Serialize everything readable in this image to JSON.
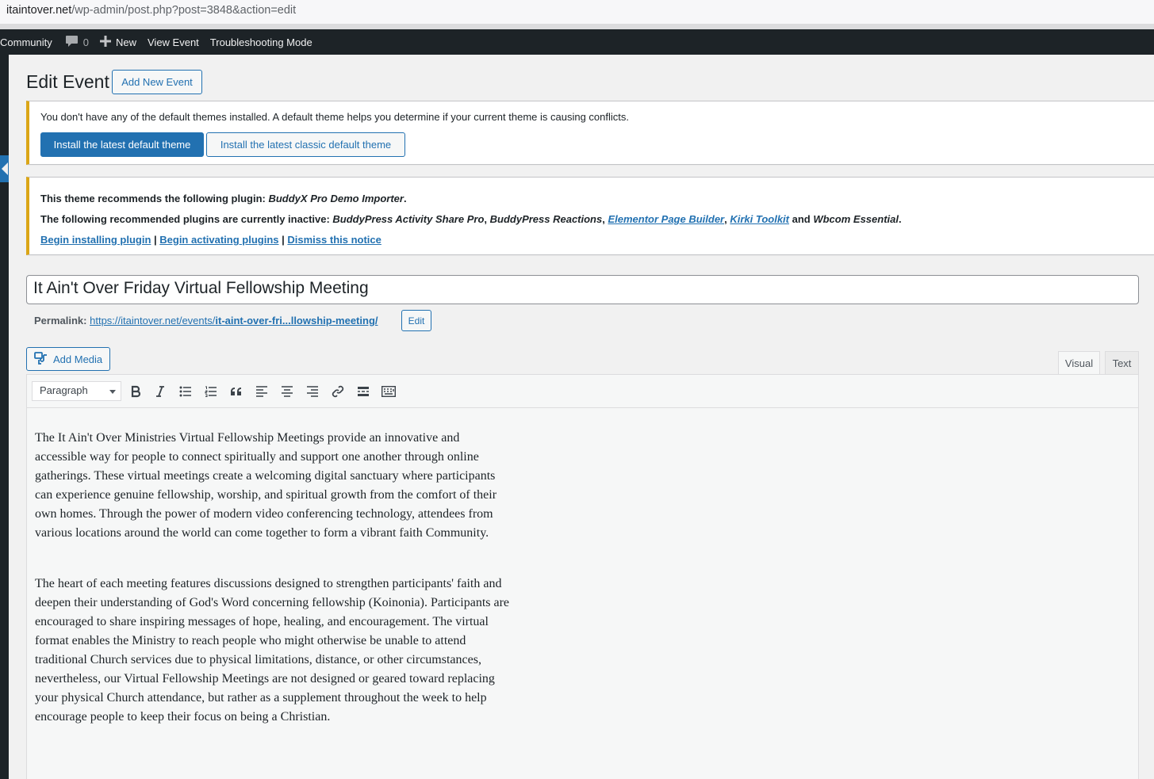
{
  "browser": {
    "url_host": "itaintover.net",
    "url_path": "/wp-admin/post.php?post=3848&action=edit"
  },
  "adminbar": {
    "site_name": "Community",
    "comments_count": "0",
    "new_label": "New",
    "view_event_label": "View Event",
    "troubleshooting_label": "Troubleshooting Mode"
  },
  "header": {
    "title": "Edit Event",
    "add_new_label": "Add New Event"
  },
  "notice_themes": {
    "message": "You don't have any of the default themes installed. A default theme helps you determine if your current theme is causing conflicts.",
    "install_default_label": "Install the latest default theme",
    "install_classic_label": "Install the latest classic default theme"
  },
  "notice_plugins": {
    "line1_prefix": "This theme recommends the following plugin: ",
    "line1_plugin": "BuddyX Pro Demo Importer",
    "line1_suffix": ".",
    "line2_prefix": "The following recommended plugins are currently inactive: ",
    "plugin_a": "BuddyPress Activity Share Pro",
    "comma1": ", ",
    "plugin_b": "BuddyPress Reactions",
    "comma2": ", ",
    "plugin_c": "Elementor Page Builder",
    "comma3": ", ",
    "plugin_d": "Kirki Toolkit",
    "and_text": " and ",
    "plugin_e": "Wbcom Essential",
    "line2_suffix": ".",
    "begin_installing": "Begin installing plugin",
    "begin_activating": "Begin activating plugins",
    "dismiss": "Dismiss this notice",
    "separator": " | "
  },
  "post": {
    "title": "It Ain't Over Friday Virtual Fellowship Meeting",
    "permalink_label": "Permalink:",
    "permalink_base": "https://itaintover.net/events/",
    "permalink_slug": "it-aint-over-fri...llowship-meeting/",
    "permalink_edit": "Edit"
  },
  "editor": {
    "add_media_label": "Add Media",
    "tab_visual": "Visual",
    "tab_text": "Text",
    "format_value": "Paragraph",
    "toolbar_icons": [
      "bold-icon",
      "italic-icon",
      "bullet-list-icon",
      "numbered-list-icon",
      "blockquote-icon",
      "align-left-icon",
      "align-center-icon",
      "align-right-icon",
      "link-icon",
      "read-more-icon",
      "toolbar-toggle-icon"
    ],
    "paragraphs": [
      "The It Ain't Over Ministries Virtual Fellowship Meetings provide an innovative and accessible way for people to connect spiritually and support one another through online gatherings. These virtual meetings create a welcoming digital sanctuary where participants can experience genuine fellowship, worship, and spiritual growth from the comfort of their own homes. Through the power of modern video conferencing technology, attendees from various locations around the world can come together to form a vibrant faith Community.",
      "The heart of each meeting features discussions designed to strengthen participants' faith and deepen their understanding of God's Word concerning fellowship (Koinonia). Participants are encouraged to share inspiring messages of hope, healing, and encouragement. The virtual format enables the Ministry to reach people who might otherwise be unable to attend traditional Church services due to physical limitations, distance, or other circumstances, nevertheless, our Virtual Fellowship Meetings are not designed or geared toward replacing your physical Church attendance, but rather as a supplement throughout the week to help encourage people to keep their focus on being a Christian."
    ]
  },
  "colors": {
    "wp_blue": "#2271b1",
    "admin_dark": "#1d2327",
    "notice_warning": "#dba617"
  }
}
